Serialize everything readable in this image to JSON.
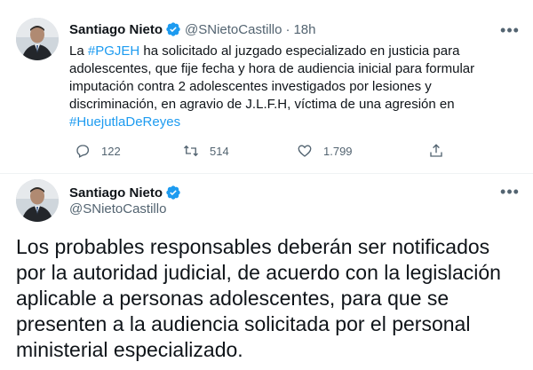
{
  "tweets": [
    {
      "author_name": "Santiago Nieto",
      "handle": "@SNietoCastillo",
      "separator": "·",
      "time": "18h",
      "body_parts": [
        {
          "text": "La ",
          "type": "text"
        },
        {
          "text": "#PGJEH",
          "type": "hashtag"
        },
        {
          "text": " ha solicitado al juzgado especializado en justicia para adolescentes, que fije fecha y hora de audiencia inicial para formular imputación contra 2 adolescentes investigados por lesiones y discriminación, en agravio de J.L.F.H, víctima de una agresión en ",
          "type": "text"
        },
        {
          "text": "#HuejutlaDeReyes",
          "type": "hashtag"
        }
      ],
      "reply_count": "122",
      "retweet_count": "514",
      "like_count": "1.799",
      "more_icon": "more-horizontal-icon"
    },
    {
      "author_name": "Santiago Nieto",
      "handle": "@SNietoCastillo",
      "body": "Los probables responsables deberán ser notificados por la autoridad judicial, de acuerdo con la legislación aplicable a personas adolescentes, para que se presenten a la audiencia solicitada por el personal ministerial especializado.",
      "more_icon": "more-horizontal-icon"
    }
  ],
  "colors": {
    "hashtag": "#1d9bf0",
    "verified": "#1d9bf0",
    "secondary_text": "#536471",
    "primary_text": "#0f1419"
  }
}
